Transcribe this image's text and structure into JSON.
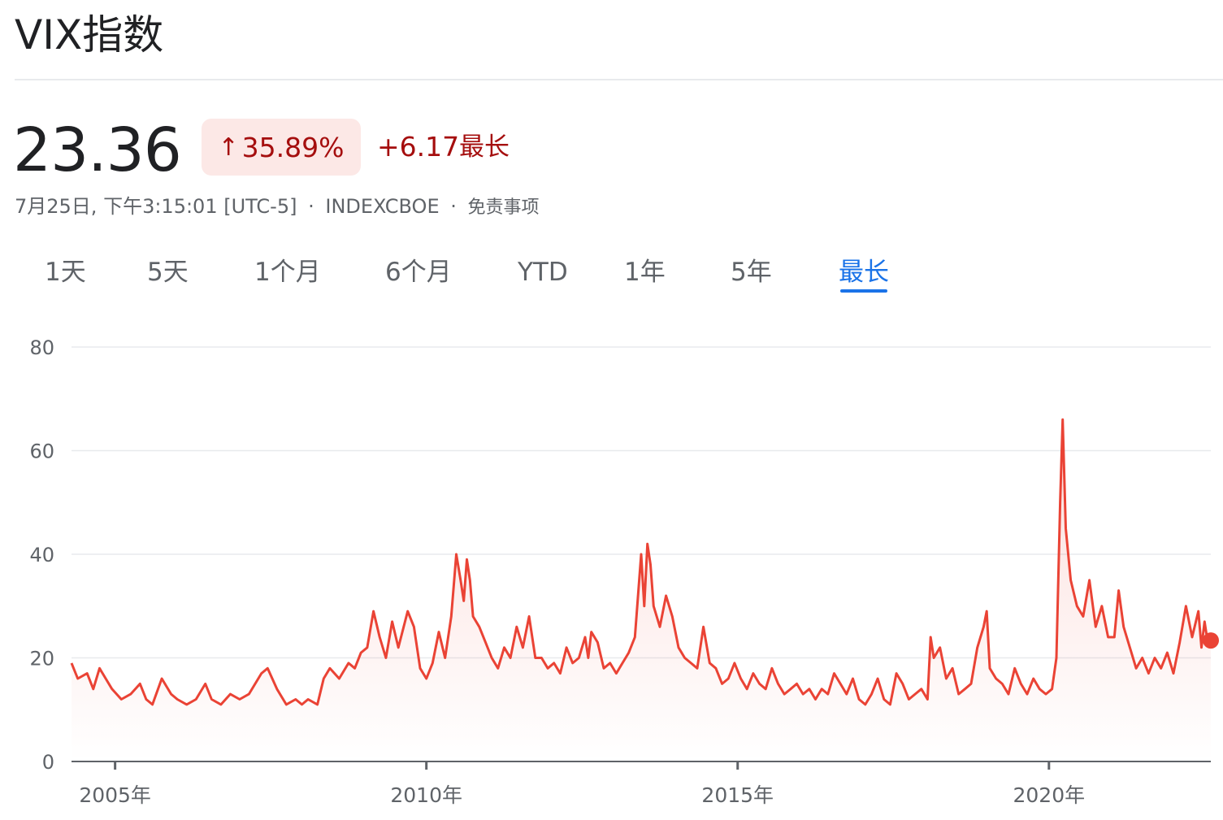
{
  "header": {
    "title": "VIX指数"
  },
  "quote": {
    "price": "23.36",
    "change_arrow": "↑",
    "change_percent": "35.89%",
    "change_absolute": "+6.17",
    "range_label": "最长",
    "timestamp": "7月25日, 下午3:15:01 [UTC-5]",
    "exchange": "INDEXCBOE",
    "disclaimer": "免责事项",
    "separator": "·"
  },
  "tabs": [
    {
      "label": "1天",
      "active": false
    },
    {
      "label": "5天",
      "active": false
    },
    {
      "label": "1个月",
      "active": false
    },
    {
      "label": "6个月",
      "active": false
    },
    {
      "label": "YTD",
      "active": false
    },
    {
      "label": "1年",
      "active": false
    },
    {
      "label": "5年",
      "active": false
    },
    {
      "label": "最长",
      "active": true
    }
  ],
  "colors": {
    "accent": "#1a73e8",
    "line": "#ea4335",
    "down_text": "#a50e0e",
    "pill_bg": "#fce8e6"
  },
  "chart_data": {
    "type": "area",
    "ylim": [
      0,
      80
    ],
    "yticks": [
      0,
      20,
      40,
      60,
      80
    ],
    "ytick_labels": [
      "0",
      "20",
      "40",
      "60",
      "80"
    ],
    "xlim": [
      2004.3,
      2022.6
    ],
    "xticks": [
      2005,
      2010,
      2015,
      2020
    ],
    "xtick_labels": [
      "2005年",
      "2010年",
      "2015年",
      "2020年"
    ],
    "grid": true,
    "series": [
      {
        "values": [
          [
            2004.3,
            19
          ],
          [
            2004.4,
            16
          ],
          [
            2004.55,
            17
          ],
          [
            2004.65,
            14
          ],
          [
            2004.75,
            18
          ],
          [
            2004.85,
            16
          ],
          [
            2004.95,
            14
          ],
          [
            2005.1,
            12
          ],
          [
            2005.25,
            13
          ],
          [
            2005.4,
            15
          ],
          [
            2005.5,
            12
          ],
          [
            2005.6,
            11
          ],
          [
            2005.75,
            16
          ],
          [
            2005.9,
            13
          ],
          [
            2006.0,
            12
          ],
          [
            2006.15,
            11
          ],
          [
            2006.3,
            12
          ],
          [
            2006.45,
            15
          ],
          [
            2006.55,
            12
          ],
          [
            2006.7,
            11
          ],
          [
            2006.85,
            13
          ],
          [
            2007.0,
            12
          ],
          [
            2007.15,
            13
          ],
          [
            2007.35,
            17
          ],
          [
            2007.45,
            18
          ],
          [
            2007.6,
            14
          ],
          [
            2007.75,
            11
          ],
          [
            2007.9,
            12
          ],
          [
            2008.0,
            11
          ],
          [
            2008.1,
            12
          ],
          [
            2008.25,
            11
          ],
          [
            2008.35,
            16
          ],
          [
            2008.45,
            18
          ],
          [
            2008.6,
            16
          ],
          [
            2008.75,
            19
          ],
          [
            2008.85,
            18
          ],
          [
            2008.95,
            21
          ],
          [
            2009.05,
            22
          ],
          [
            2009.15,
            29
          ],
          [
            2009.25,
            24
          ],
          [
            2009.35,
            20
          ],
          [
            2009.45,
            27
          ],
          [
            2009.55,
            22
          ],
          [
            2009.7,
            29
          ],
          [
            2009.8,
            26
          ],
          [
            2009.9,
            18
          ],
          [
            2010.0,
            16
          ],
          [
            2010.1,
            19
          ],
          [
            2010.2,
            25
          ],
          [
            2010.3,
            20
          ],
          [
            2010.4,
            28
          ],
          [
            2010.48,
            40
          ],
          [
            2010.55,
            35
          ],
          [
            2010.6,
            31
          ],
          [
            2010.65,
            39
          ],
          [
            2010.7,
            35
          ],
          [
            2010.75,
            28
          ],
          [
            2010.85,
            26
          ],
          [
            2010.95,
            23
          ],
          [
            2011.05,
            20
          ],
          [
            2011.15,
            18
          ],
          [
            2011.25,
            22
          ],
          [
            2011.35,
            20
          ],
          [
            2011.45,
            26
          ],
          [
            2011.55,
            22
          ],
          [
            2011.65,
            28
          ],
          [
            2011.75,
            20
          ],
          [
            2011.85,
            20
          ],
          [
            2011.95,
            18
          ],
          [
            2012.05,
            19
          ],
          [
            2012.15,
            17
          ],
          [
            2012.25,
            22
          ],
          [
            2012.35,
            19
          ],
          [
            2012.45,
            20
          ],
          [
            2012.55,
            24
          ],
          [
            2012.6,
            20
          ],
          [
            2012.65,
            25
          ],
          [
            2012.75,
            23
          ],
          [
            2012.85,
            18
          ],
          [
            2012.95,
            19
          ],
          [
            2013.05,
            17
          ],
          [
            2013.15,
            19
          ],
          [
            2013.25,
            21
          ],
          [
            2013.35,
            24
          ],
          [
            2013.45,
            40
          ],
          [
            2013.5,
            30
          ],
          [
            2013.55,
            42
          ],
          [
            2013.6,
            38
          ],
          [
            2013.65,
            30
          ],
          [
            2013.75,
            26
          ],
          [
            2013.85,
            32
          ],
          [
            2013.95,
            28
          ],
          [
            2014.05,
            22
          ],
          [
            2014.15,
            20
          ],
          [
            2014.25,
            19
          ],
          [
            2014.35,
            18
          ],
          [
            2014.45,
            26
          ],
          [
            2014.55,
            19
          ],
          [
            2014.65,
            18
          ],
          [
            2014.75,
            15
          ],
          [
            2014.85,
            16
          ],
          [
            2014.95,
            19
          ],
          [
            2015.05,
            16
          ],
          [
            2015.15,
            14
          ],
          [
            2015.25,
            17
          ],
          [
            2015.35,
            15
          ],
          [
            2015.45,
            14
          ],
          [
            2015.55,
            18
          ],
          [
            2015.65,
            15
          ],
          [
            2015.75,
            13
          ],
          [
            2015.85,
            14
          ],
          [
            2015.95,
            15
          ],
          [
            2016.05,
            13
          ],
          [
            2016.15,
            14
          ],
          [
            2016.25,
            12
          ],
          [
            2016.35,
            14
          ],
          [
            2016.45,
            13
          ],
          [
            2016.55,
            17
          ],
          [
            2016.65,
            15
          ],
          [
            2016.75,
            13
          ],
          [
            2016.85,
            16
          ],
          [
            2016.95,
            12
          ],
          [
            2017.05,
            11
          ],
          [
            2017.15,
            13
          ],
          [
            2017.25,
            16
          ],
          [
            2017.35,
            12
          ],
          [
            2017.45,
            11
          ],
          [
            2017.55,
            17
          ],
          [
            2017.65,
            15
          ],
          [
            2017.75,
            12
          ],
          [
            2017.85,
            13
          ],
          [
            2017.95,
            14
          ],
          [
            2018.05,
            12
          ],
          [
            2018.1,
            24
          ],
          [
            2018.15,
            20
          ],
          [
            2018.25,
            22
          ],
          [
            2018.35,
            16
          ],
          [
            2018.45,
            18
          ],
          [
            2018.55,
            13
          ],
          [
            2018.65,
            14
          ],
          [
            2018.75,
            15
          ],
          [
            2018.85,
            22
          ],
          [
            2018.95,
            26
          ],
          [
            2019.0,
            29
          ],
          [
            2019.05,
            18
          ],
          [
            2019.15,
            16
          ],
          [
            2019.25,
            15
          ],
          [
            2019.35,
            13
          ],
          [
            2019.45,
            18
          ],
          [
            2019.55,
            15
          ],
          [
            2019.65,
            13
          ],
          [
            2019.75,
            16
          ],
          [
            2019.85,
            14
          ],
          [
            2019.95,
            13
          ],
          [
            2020.05,
            14
          ],
          [
            2020.12,
            20
          ],
          [
            2020.18,
            50
          ],
          [
            2020.22,
            66
          ],
          [
            2020.27,
            45
          ],
          [
            2020.35,
            35
          ],
          [
            2020.45,
            30
          ],
          [
            2020.55,
            28
          ],
          [
            2020.65,
            35
          ],
          [
            2020.75,
            26
          ],
          [
            2020.85,
            30
          ],
          [
            2020.95,
            24
          ],
          [
            2021.05,
            24
          ],
          [
            2021.12,
            33
          ],
          [
            2021.2,
            26
          ],
          [
            2021.3,
            22
          ],
          [
            2021.4,
            18
          ],
          [
            2021.5,
            20
          ],
          [
            2021.6,
            17
          ],
          [
            2021.7,
            20
          ],
          [
            2021.8,
            18
          ],
          [
            2021.9,
            21
          ],
          [
            2022.0,
            17
          ],
          [
            2022.1,
            23
          ],
          [
            2022.2,
            30
          ],
          [
            2022.3,
            24
          ],
          [
            2022.4,
            29
          ],
          [
            2022.45,
            22
          ],
          [
            2022.5,
            27
          ],
          [
            2022.55,
            23
          ],
          [
            2022.6,
            23.36
          ]
        ]
      }
    ],
    "last_value": 23.36
  }
}
